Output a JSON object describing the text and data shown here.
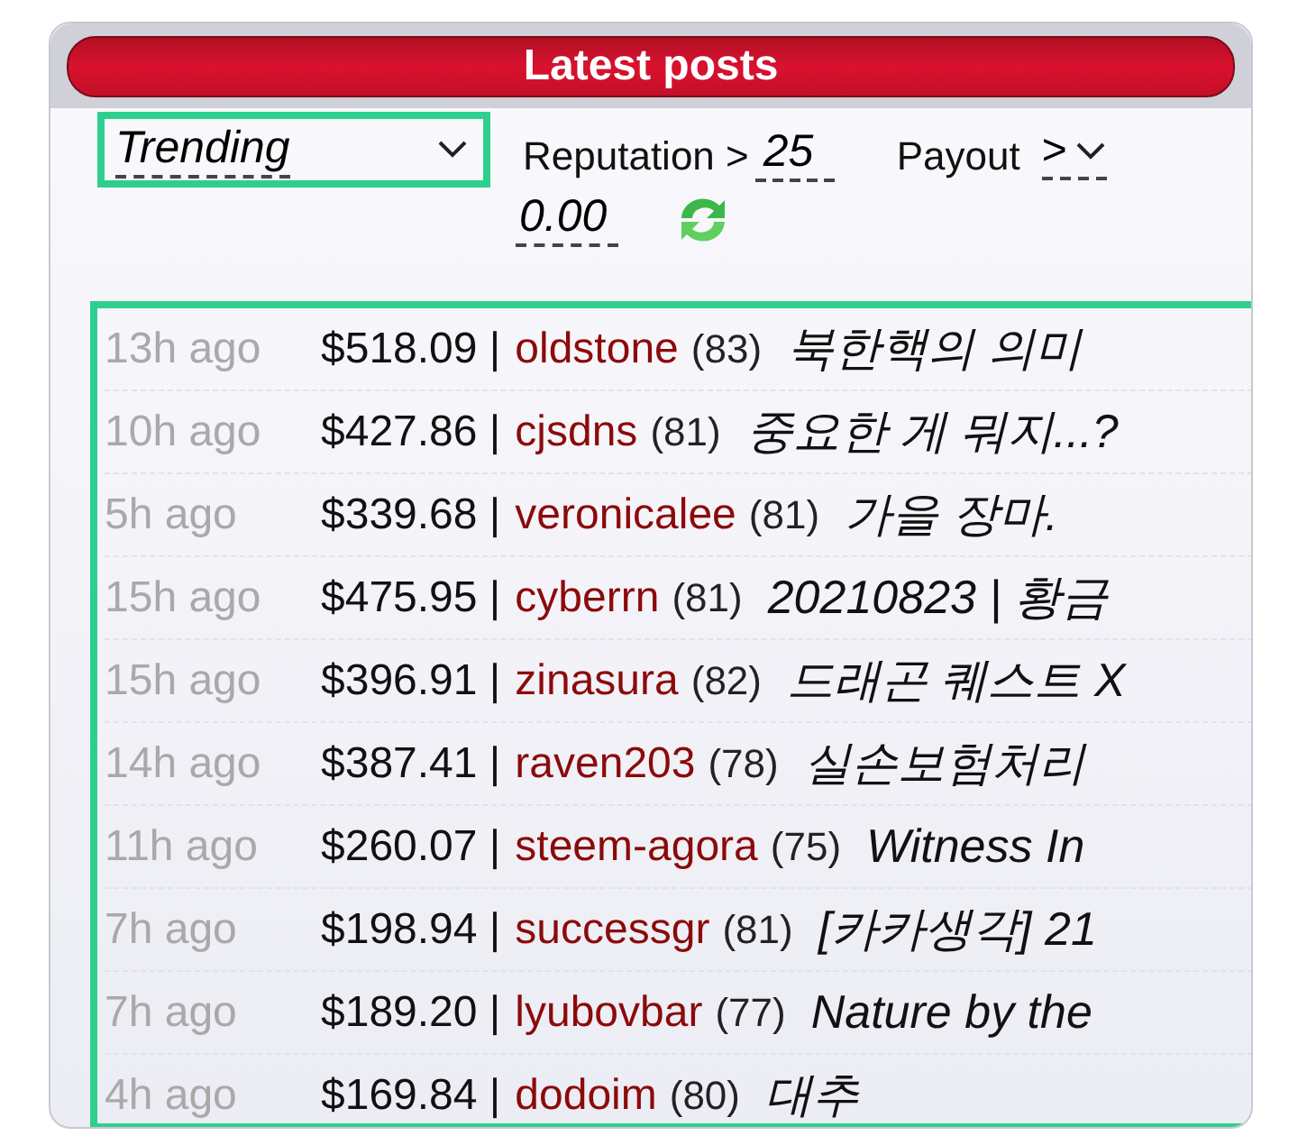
{
  "panel": {
    "title": "Latest posts"
  },
  "filters": {
    "sort": {
      "value": "Trending",
      "highlighted": true
    },
    "reputation": {
      "label": "Reputation >",
      "value": "25"
    },
    "payout": {
      "label": "Payout",
      "value": ">",
      "amount": "0.00"
    }
  },
  "posts_highlighted": true,
  "posts": [
    {
      "age": "13h ago",
      "payout": "$518.09 |",
      "author": "oldstone",
      "reputation": "(83)",
      "title": "북한핵의 의미"
    },
    {
      "age": "10h ago",
      "payout": "$427.86 |",
      "author": "cjsdns",
      "reputation": "(81)",
      "title": "중요한 게 뭐지...?"
    },
    {
      "age": "5h ago",
      "payout": "$339.68 |",
      "author": "veronicalee",
      "reputation": "(81)",
      "title": "가을 장마."
    },
    {
      "age": "15h ago",
      "payout": "$475.95 |",
      "author": "cyberrn",
      "reputation": "(81)",
      "title": "20210823 | 황금"
    },
    {
      "age": "15h ago",
      "payout": "$396.91 |",
      "author": "zinasura",
      "reputation": "(82)",
      "title": "드래곤 퀘스트 X"
    },
    {
      "age": "14h ago",
      "payout": "$387.41 |",
      "author": "raven203",
      "reputation": "(78)",
      "title": "실손보험처리"
    },
    {
      "age": "11h ago",
      "payout": "$260.07 |",
      "author": "steem-agora",
      "reputation": "(75)",
      "title": "Witness In"
    },
    {
      "age": "7h ago",
      "payout": "$198.94 |",
      "author": "successgr",
      "reputation": "(81)",
      "title": "[카카생각] 21"
    },
    {
      "age": "7h ago",
      "payout": "$189.20 |",
      "author": "lyubovbar",
      "reputation": "(77)",
      "title": "Nature by the"
    },
    {
      "age": "4h ago",
      "payout": "$169.84 |",
      "author": "dodoim",
      "reputation": "(80)",
      "title": "대추"
    }
  ]
}
